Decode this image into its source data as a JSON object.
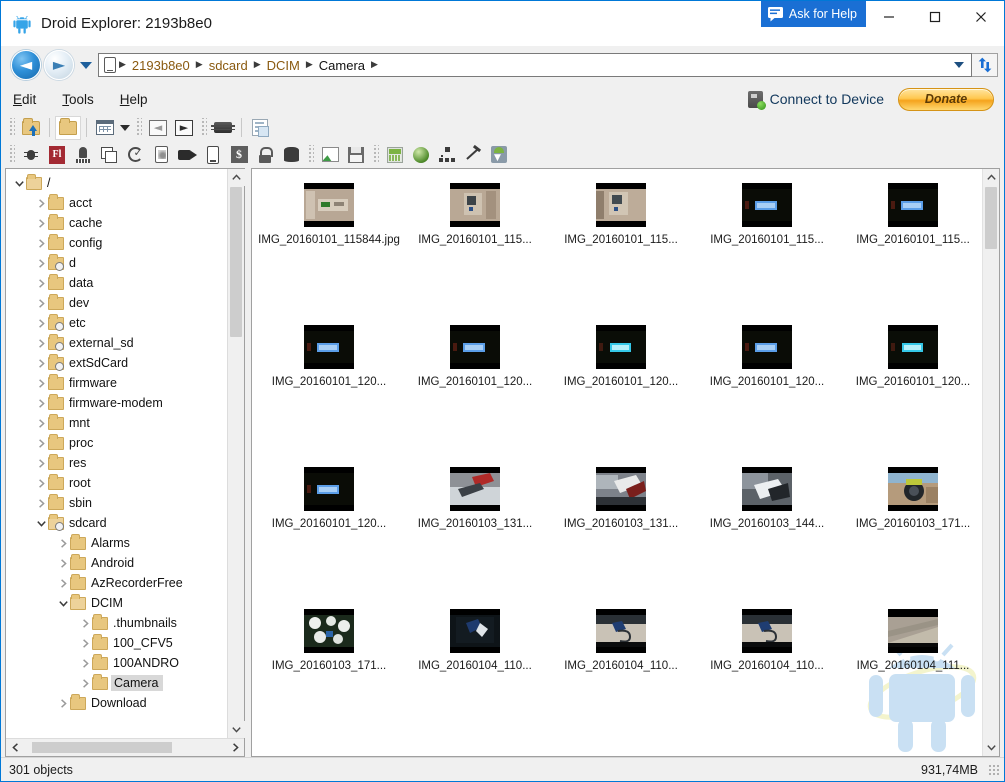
{
  "window": {
    "title": "Droid Explorer: 2193b8e0",
    "app_icon": "android-robot-icon",
    "ask_for_help": "Ask for Help",
    "minimize": "—",
    "maximize": "☐",
    "close": "✕"
  },
  "address_bar": {
    "back_icon": "back-arrow-icon",
    "forward_icon": "forward-arrow-icon",
    "history_icon": "chevron-down-icon",
    "device_icon": "phone-icon",
    "crumbs": [
      {
        "label": "2193b8e0",
        "style": "amber"
      },
      {
        "label": "sdcard",
        "style": "amber"
      },
      {
        "label": "DCIM",
        "style": "amber"
      },
      {
        "label": "Camera",
        "style": "plain"
      }
    ],
    "separator": "▶",
    "dropdown_icon": "chevron-down-icon",
    "refresh_icon": "refresh-icon"
  },
  "menu": {
    "items": [
      {
        "label": "Edit",
        "mnemonic": "E"
      },
      {
        "label": "Tools",
        "mnemonic": "T"
      },
      {
        "label": "Help",
        "mnemonic": "H"
      }
    ],
    "connect_to_device": "Connect to Device",
    "connect_icon": "device-connect-icon",
    "donate": "Donate"
  },
  "toolbar_row1": [
    {
      "name": "navigate-up-icon",
      "kind": "folder-up"
    },
    {
      "sep": true
    },
    {
      "name": "new-folder-icon",
      "kind": "folder",
      "active": true
    },
    {
      "sep": true
    },
    {
      "name": "view-mode-icon",
      "kind": "grid",
      "dropdown": true
    },
    {
      "grip": true
    },
    {
      "name": "back-icon",
      "kind": "sq-arrow-left"
    },
    {
      "name": "forward-icon",
      "kind": "sq-arrow-right"
    },
    {
      "grip": true
    },
    {
      "name": "chipset-icon",
      "kind": "chip"
    },
    {
      "sep": true
    },
    {
      "name": "bug-report-icon",
      "kind": "report"
    }
  ],
  "toolbar_row2": [
    {
      "grip": true
    },
    {
      "name": "bug-icon",
      "kind": "bug"
    },
    {
      "name": "flash-icon",
      "kind": "fl",
      "label": "Fl"
    },
    {
      "name": "hydrant-icon",
      "kind": "hydrant"
    },
    {
      "name": "window-stack-icon",
      "kind": "stack"
    },
    {
      "name": "reboot-icon",
      "kind": "refresh-check"
    },
    {
      "name": "screen-capture-icon",
      "kind": "screencap"
    },
    {
      "name": "screen-record-icon",
      "kind": "camcorder"
    },
    {
      "name": "device-icon",
      "kind": "phone2"
    },
    {
      "name": "shell-icon",
      "kind": "shell",
      "label": "$"
    },
    {
      "name": "unlock-icon",
      "kind": "lock"
    },
    {
      "name": "database-icon",
      "kind": "db"
    },
    {
      "grip": true
    },
    {
      "name": "image-open-icon",
      "kind": "img"
    },
    {
      "name": "save-image-icon",
      "kind": "save"
    },
    {
      "grip": true
    },
    {
      "name": "apk-manager-icon",
      "kind": "apk"
    },
    {
      "name": "browser-icon",
      "kind": "globe"
    },
    {
      "name": "network-icon",
      "kind": "tree"
    },
    {
      "name": "build-icon",
      "kind": "hammer"
    },
    {
      "name": "adb-download-icon",
      "kind": "adl"
    }
  ],
  "tree": {
    "nodes": [
      {
        "label": "/",
        "depth": 0,
        "expanded": true,
        "icon": "folder-open-icon"
      },
      {
        "label": "acct",
        "depth": 1,
        "expanded": false,
        "icon": "folder-icon"
      },
      {
        "label": "cache",
        "depth": 1,
        "expanded": false,
        "icon": "folder-icon"
      },
      {
        "label": "config",
        "depth": 1,
        "expanded": false,
        "icon": "folder-icon"
      },
      {
        "label": "d",
        "depth": 1,
        "expanded": false,
        "icon": "folder-link-icon"
      },
      {
        "label": "data",
        "depth": 1,
        "expanded": false,
        "icon": "folder-icon"
      },
      {
        "label": "dev",
        "depth": 1,
        "expanded": false,
        "icon": "folder-icon"
      },
      {
        "label": "etc",
        "depth": 1,
        "expanded": false,
        "icon": "folder-link-icon"
      },
      {
        "label": "external_sd",
        "depth": 1,
        "expanded": false,
        "icon": "folder-link-icon"
      },
      {
        "label": "extSdCard",
        "depth": 1,
        "expanded": false,
        "icon": "folder-link-icon"
      },
      {
        "label": "firmware",
        "depth": 1,
        "expanded": false,
        "icon": "folder-icon"
      },
      {
        "label": "firmware-modem",
        "depth": 1,
        "expanded": false,
        "icon": "folder-icon"
      },
      {
        "label": "mnt",
        "depth": 1,
        "expanded": false,
        "icon": "folder-icon"
      },
      {
        "label": "proc",
        "depth": 1,
        "expanded": false,
        "icon": "folder-icon"
      },
      {
        "label": "res",
        "depth": 1,
        "expanded": false,
        "icon": "folder-icon"
      },
      {
        "label": "root",
        "depth": 1,
        "expanded": false,
        "icon": "folder-icon"
      },
      {
        "label": "sbin",
        "depth": 1,
        "expanded": false,
        "icon": "folder-icon"
      },
      {
        "label": "sdcard",
        "depth": 1,
        "expanded": true,
        "icon": "folder-link-open-icon"
      },
      {
        "label": "Alarms",
        "depth": 2,
        "expanded": false,
        "icon": "folder-icon"
      },
      {
        "label": "Android",
        "depth": 2,
        "expanded": false,
        "icon": "folder-icon"
      },
      {
        "label": "AzRecorderFree",
        "depth": 2,
        "expanded": false,
        "icon": "folder-icon"
      },
      {
        "label": "DCIM",
        "depth": 2,
        "expanded": true,
        "icon": "folder-open-icon"
      },
      {
        "label": ".thumbnails",
        "depth": 3,
        "expanded": false,
        "icon": "folder-icon"
      },
      {
        "label": "100_CFV5",
        "depth": 3,
        "expanded": false,
        "icon": "folder-icon"
      },
      {
        "label": "100ANDRO",
        "depth": 3,
        "expanded": false,
        "icon": "folder-icon"
      },
      {
        "label": "Camera",
        "depth": 3,
        "expanded": false,
        "icon": "folder-icon",
        "selected": true
      },
      {
        "label": "Download",
        "depth": 2,
        "expanded": false,
        "icon": "folder-icon"
      }
    ],
    "scroll_up_icon": "chevron-up-icon",
    "scroll_down_icon": "chevron-down-icon",
    "scroll_left_icon": "chevron-left-icon",
    "scroll_right_icon": "chevron-right-icon"
  },
  "files": {
    "watermark_icon": "android-watermark-icon",
    "scroll_up_icon": "chevron-up-icon",
    "scroll_down_icon": "chevron-down-icon",
    "items": [
      {
        "name": "IMG_20160101_115844.jpg",
        "thumb": "photo-room-bright"
      },
      {
        "name": "IMG_20160101_115...",
        "thumb": "photo-room-wall"
      },
      {
        "name": "IMG_20160101_115...",
        "thumb": "photo-room-wall2"
      },
      {
        "name": "IMG_20160101_115...",
        "thumb": "photo-dark-lcd-blue"
      },
      {
        "name": "IMG_20160101_115...",
        "thumb": "photo-dark-lcd-blue"
      },
      {
        "name": "IMG_20160101_120...",
        "thumb": "photo-dark-lcd-blue"
      },
      {
        "name": "IMG_20160101_120...",
        "thumb": "photo-dark-lcd-blue"
      },
      {
        "name": "IMG_20160101_120...",
        "thumb": "photo-dark-lcd-cyan"
      },
      {
        "name": "IMG_20160101_120...",
        "thumb": "photo-dark-lcd-blue"
      },
      {
        "name": "IMG_20160101_120...",
        "thumb": "photo-dark-lcd-cyan"
      },
      {
        "name": "IMG_20160101_120...",
        "thumb": "photo-dark-lcd-blue"
      },
      {
        "name": "IMG_20160103_131...",
        "thumb": "photo-desk-tool"
      },
      {
        "name": "IMG_20160103_131...",
        "thumb": "photo-desk-hand"
      },
      {
        "name": "IMG_20160103_144...",
        "thumb": "photo-desk-dark"
      },
      {
        "name": "IMG_20160103_171...",
        "thumb": "photo-camera-table"
      },
      {
        "name": "IMG_20160103_171...",
        "thumb": "photo-parts-white"
      },
      {
        "name": "IMG_20160104_110...",
        "thumb": "photo-usb-dark"
      },
      {
        "name": "IMG_20160104_110...",
        "thumb": "photo-cable-desk"
      },
      {
        "name": "IMG_20160104_110...",
        "thumb": "photo-cable-desk"
      },
      {
        "name": "IMG_20160104_111...",
        "thumb": "photo-floor-wood"
      }
    ]
  },
  "statusbar": {
    "objects": "301 objects",
    "size": "931,74MB",
    "grip_icon": "resize-grip-icon"
  },
  "colors": {
    "accent": "#1a6fd4",
    "window_border": "#0078d7",
    "chrome": "#f0f0f0",
    "crumb_amber": "#8a5a10",
    "donate_gold": "#f5a31c"
  }
}
